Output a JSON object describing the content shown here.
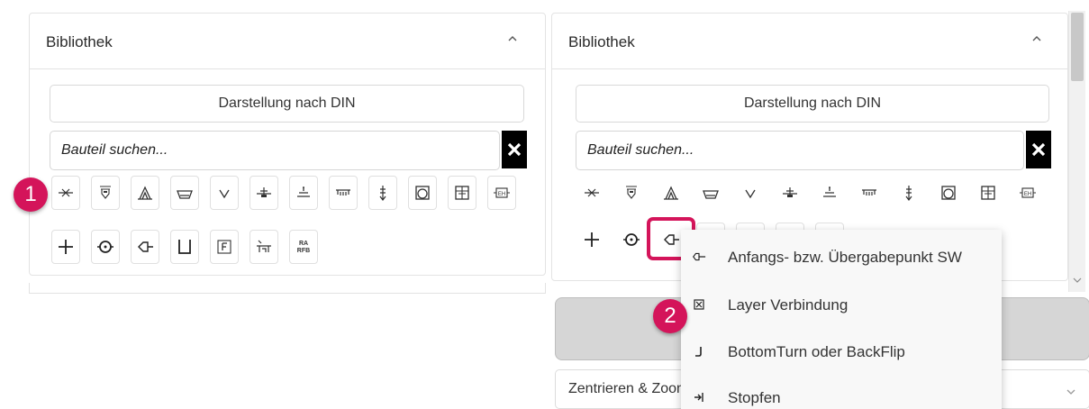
{
  "left_panel": {
    "title": "Bibliothek",
    "din_button_label": "Darstellung nach DIN",
    "search_placeholder": "Bauteil suchen..."
  },
  "right_panel": {
    "title": "Bibliothek",
    "din_button_label": "Darstellung nach DIN",
    "search_placeholder": "Bauteil suchen..."
  },
  "symbols_row1": [
    "branch-symbol",
    "manhole-cover-symbol",
    "tent-symbol",
    "basin-symbol",
    "arrow-down-symbol",
    "valve-symbol",
    "outlet-symbol",
    "grate-symbol",
    "hydrant-symbol",
    "pump-symbol",
    "cabinet-symbol",
    "eh-symbol"
  ],
  "symbols_row2": [
    "cross-symbol",
    "meter-symbol",
    "start-point-symbol",
    "container-symbol",
    "f-box-symbol",
    "separator-symbol",
    "ra-rfb-symbol"
  ],
  "badges": {
    "step1": "1",
    "step2": "2"
  },
  "dropdown": {
    "items": [
      {
        "label": "Anfangs- bzw. Übergabepunkt SW",
        "icon": "start-point-icon"
      },
      {
        "label": "Layer Verbindung",
        "icon": "layer-connection-icon"
      },
      {
        "label": "BottomTurn oder BackFlip",
        "icon": "bottom-turn-icon"
      },
      {
        "label": "Stopfen",
        "icon": "plug-icon"
      }
    ]
  },
  "zentrieren_label": "Zentrieren & Zoom",
  "colors": {
    "accent": "#d4145a",
    "panel_border": "#e3e3e3"
  }
}
